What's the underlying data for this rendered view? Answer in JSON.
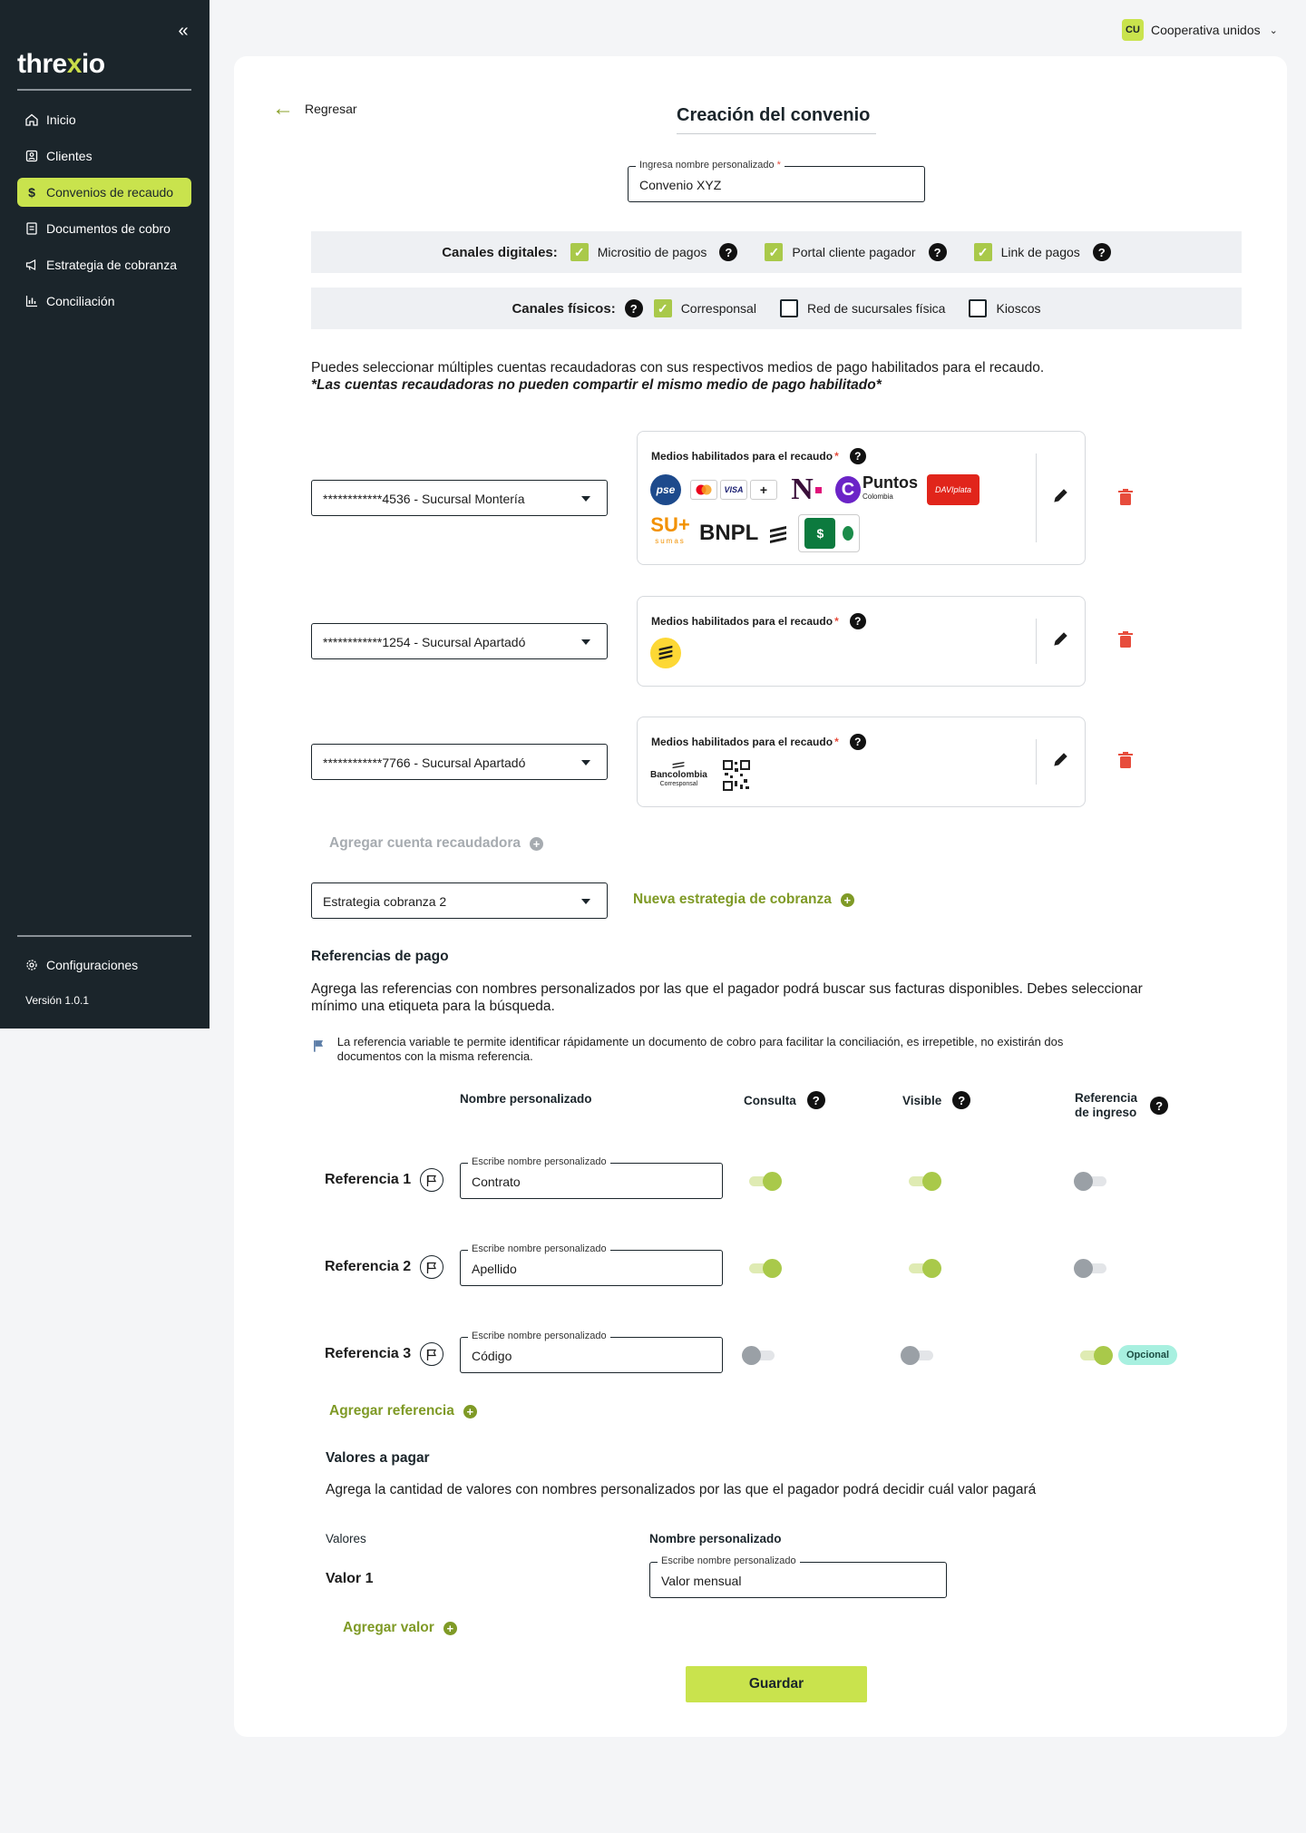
{
  "app": {
    "logo": "threxio",
    "version": "Versión 1.0.1"
  },
  "sidebar": {
    "items": [
      {
        "label": "Inicio",
        "icon": "home-icon"
      },
      {
        "label": "Clientes",
        "icon": "user-card-icon"
      },
      {
        "label": "Convenios de recaudo",
        "icon": "dollar-icon",
        "active": true
      },
      {
        "label": "Documentos de cobro",
        "icon": "document-icon"
      },
      {
        "label": "Estrategia de cobranza",
        "icon": "megaphone-icon"
      },
      {
        "label": "Conciliación",
        "icon": "bar-chart-icon"
      }
    ],
    "config_label": "Configuraciones"
  },
  "user": {
    "initials": "CU",
    "name": "Cooperativa unidos"
  },
  "header": {
    "back_label": "Regresar",
    "title": "Creación del convenio"
  },
  "convenio": {
    "label": "Ingresa nombre personalizado",
    "required": "*",
    "value": "Convenio XYZ"
  },
  "canales_digitales": {
    "title": "Canales digitales:",
    "options": [
      {
        "label": "Micrositio de pagos",
        "checked": true
      },
      {
        "label": "Portal cliente pagador",
        "checked": true
      },
      {
        "label": "Link de pagos",
        "checked": true
      }
    ]
  },
  "canales_fisicos": {
    "title": "Canales físicos:",
    "options": [
      {
        "label": "Corresponsal",
        "checked": true
      },
      {
        "label": "Red de sucursales física",
        "checked": false
      },
      {
        "label": "Kioscos",
        "checked": false
      }
    ]
  },
  "info": {
    "line1": "Puedes seleccionar múltiples cuentas recaudadoras con sus respectivos medios de pago habilitados para el recaudo.",
    "line2": "*Las cuentas recaudadoras no pueden compartir el mismo medio de pago habilitado*"
  },
  "cuentas": [
    {
      "account": "************4536 - Sucursal Montería",
      "media_label": "Medios habilitados para el recaudo",
      "logos": [
        "pse",
        "mastercard",
        "visa",
        "+",
        "N",
        "Puntos Colombia",
        "daviplata",
        "SU+ sumas",
        "BNPL",
        "bancolombia-icon",
        "nequi"
      ]
    },
    {
      "account": "************1254 - Sucursal Apartadó",
      "media_label": "Medios habilitados para el recaudo",
      "logos": [
        "bancolombia-icon"
      ]
    },
    {
      "account": "************7766 - Sucursal Apartadó",
      "media_label": "Medios habilitados para el recaudo",
      "logos": [
        "Bancolombia Corresponsal",
        "qr"
      ]
    }
  ],
  "logo_text": {
    "pse": "pse",
    "visa": "VISA",
    "plus": "+",
    "n": "N",
    "puntos": "Puntos",
    "puntos_sub": "Colombia",
    "davi": "DAVIplata",
    "sumas": "SU+",
    "sumas_sub": "sumas",
    "bnpl": "BNPL",
    "banco": "Bancolombia",
    "banco_sub": "Corresponsal"
  },
  "required_mark": "*",
  "agregar_cuenta": "Agregar cuenta recaudadora",
  "estrategia": {
    "value": "Estrategia cobranza 2",
    "nueva": "Nueva estrategia de cobranza"
  },
  "referencias": {
    "title": "Referencias de pago",
    "description": "Agrega las referencias con nombres personalizados por las que el pagador podrá buscar sus facturas disponibles. Debes seleccionar mínimo una etiqueta para la búsqueda.",
    "note": "La referencia variable te permite identificar rápidamente un documento de cobro para facilitar la conciliación, es irrepetible, no existirán dos documentos con la misma referencia.",
    "columns": {
      "nombre": "Nombre personalizado",
      "consulta": "Consulta",
      "visible": "Visible",
      "ingreso_1": "Referencia",
      "ingreso_2": "de ingreso"
    },
    "rows": [
      {
        "label": "Referencia 1",
        "field_label": "Escribe nombre personalizado",
        "value": "Contrato",
        "consulta": true,
        "visible": true,
        "ingreso": false
      },
      {
        "label": "Referencia 2",
        "field_label": "Escribe nombre personalizado",
        "value": "Apellido",
        "consulta": true,
        "visible": true,
        "ingreso": false
      },
      {
        "label": "Referencia 3",
        "field_label": "Escribe nombre personalizado",
        "value": "Código",
        "consulta": false,
        "visible": false,
        "ingreso": true,
        "badge": "Opcional"
      }
    ],
    "agregar": "Agregar referencia"
  },
  "valores": {
    "title": "Valores a pagar",
    "description": "Agrega la cantidad de valores con nombres personalizados por las que el pagador podrá decidir cuál valor pagará",
    "col_valores": "Valores",
    "col_nombre": "Nombre personalizado",
    "rows": [
      {
        "label": "Valor 1",
        "field_label": "Escribe nombre personalizado",
        "value": "Valor mensual"
      }
    ],
    "agregar": "Agregar valor"
  },
  "save_label": "Guardar",
  "colors": {
    "accent": "#c9e34d",
    "sidebar": "#1b252b",
    "green_text": "#7f9a26",
    "danger": "#e74c3c"
  }
}
